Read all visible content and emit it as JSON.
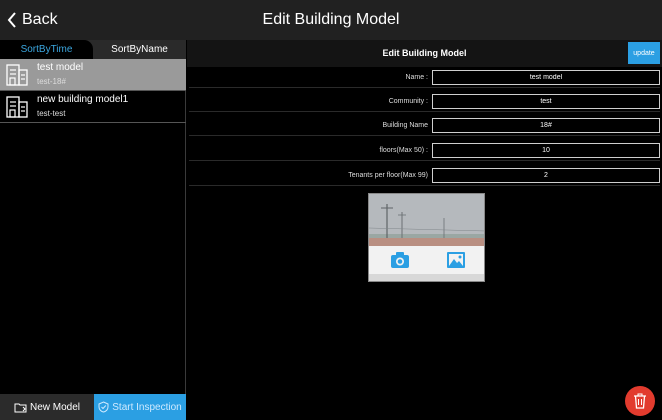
{
  "header": {
    "back_label": "Back",
    "title": "Edit Building Model"
  },
  "sidebar": {
    "tabs": [
      {
        "label": "SortByTime",
        "active": true
      },
      {
        "label": "SortByName",
        "active": false
      }
    ],
    "models": [
      {
        "name": "test model",
        "sub": "test-18#",
        "selected": true
      },
      {
        "name": "new building model1",
        "sub": "test-test",
        "selected": false
      }
    ],
    "new_model_label": "New Model",
    "start_inspection_label": "Start Inspection"
  },
  "form": {
    "title": "Edit Building Model",
    "update_label": "update",
    "fields": [
      {
        "label": "Name :",
        "value": "test model"
      },
      {
        "label": "Community :",
        "value": "test"
      },
      {
        "label": "Building Name",
        "value": "18#"
      },
      {
        "label": "floors(Max 50) :",
        "value": "10"
      },
      {
        "label": "Tenants per floor(Max 99)",
        "value": "2"
      }
    ]
  },
  "icons": {
    "back": "chevron-left-icon",
    "building": "building-icon",
    "new_model": "add-folder-icon",
    "start_inspection": "shield-check-icon",
    "camera": "camera-icon",
    "gallery": "image-icon",
    "delete": "trash-icon"
  },
  "colors": {
    "accent": "#2b9fe3",
    "selected_row": "#9a9a9a",
    "delete": "#e23b2e",
    "background": "#000000",
    "topbar": "#212121"
  }
}
